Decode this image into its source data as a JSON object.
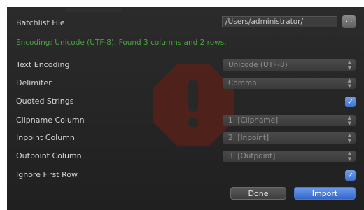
{
  "batchlist": {
    "label": "Batchlist File",
    "path_value": "/Users/administrator/",
    "browse_label": "..."
  },
  "status_message": "Encoding: Unicode (UTF-8). Found 3 columns and 2 rows.",
  "fields": {
    "text_encoding": {
      "label": "Text Encoding",
      "value": "Unicode (UTF-8)"
    },
    "delimiter": {
      "label": "Delimiter",
      "value": "Comma"
    },
    "quoted_strings": {
      "label": "Quoted Strings",
      "checked": true
    },
    "clipname_column": {
      "label": "Clipname Column",
      "value": "1. [Clipname]"
    },
    "inpoint_column": {
      "label": "Inpoint Column",
      "value": "2. [Inpoint]"
    },
    "outpoint_column": {
      "label": "Outpoint Column",
      "value": "3. [Outpoint]"
    },
    "ignore_first_row": {
      "label": "Ignore First Row",
      "checked": true
    }
  },
  "buttons": {
    "done": "Done",
    "import": "Import"
  },
  "glyphs": {
    "check": "✓",
    "updown": "▲▼",
    "exclamation": "!"
  },
  "colors": {
    "status_green": "#49a43d",
    "accent_blue": "#3f72c8",
    "warning_red": "#5d2018"
  }
}
